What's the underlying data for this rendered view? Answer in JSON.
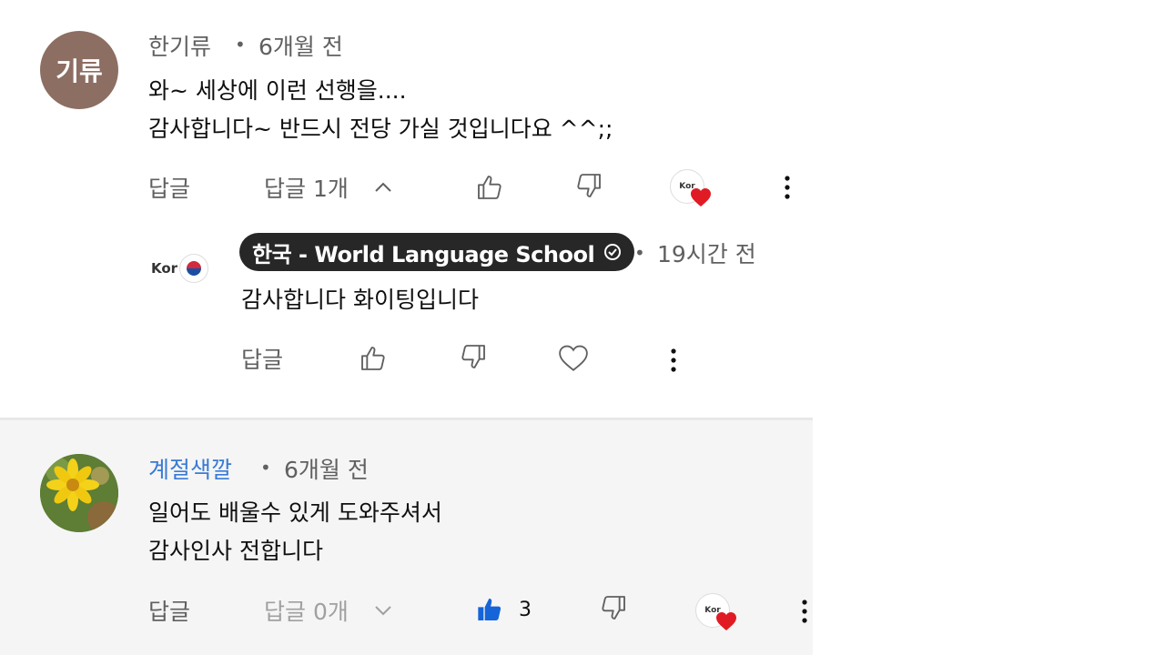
{
  "comments": [
    {
      "avatar_letters": "기류",
      "avatar_color": "#8d6e63",
      "author": "한기류",
      "separator": "•",
      "time": "6개월 전",
      "lines": [
        "와~  세상에 이런 선행을....",
        "감사합니다~ 반드시 전당 가실 것입니다요 ^^;;"
      ],
      "reply_label": "답글",
      "replies_toggle": "답글 1개",
      "replies_icon": "chevron-up",
      "like_count": "",
      "liked": false,
      "creator_hearted": true
    },
    {
      "avatar_letters": "",
      "avatar_color": "#6a8f3a",
      "author": "계절색깔",
      "separator": "•",
      "time": "6개월 전",
      "lines": [
        "일어도 배울수 있게 도와주셔서",
        "감사인사 전합니다"
      ],
      "reply_label": "답글",
      "replies_toggle": "답글 0개",
      "replies_icon": "chevron-down",
      "like_count": "3",
      "liked": true,
      "creator_hearted": true
    }
  ],
  "reply": {
    "avatar_logo_text": "Kor",
    "author": "한국 - World Language School",
    "verified_icon": "check-circle-icon",
    "separator": "•",
    "time": "19시간 전",
    "text": "감사합니다 화이팅입니다",
    "reply_label": "답글"
  },
  "colors": {
    "like_active": "#1565d8",
    "heart_red": "#e01b24",
    "link_blue": "#3a7bd5",
    "owner_badge_bg": "#272727"
  }
}
